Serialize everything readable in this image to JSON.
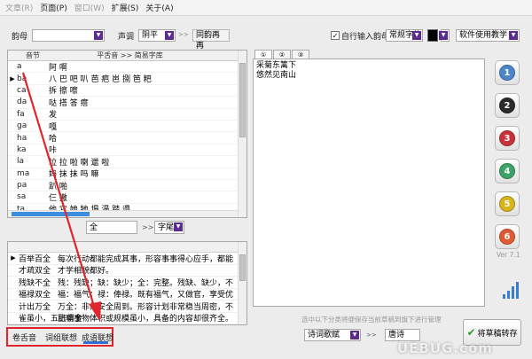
{
  "menu": [
    "文章(R)",
    "页面(P)",
    "窗口(W)",
    "扩展(S)",
    "关于(A)"
  ],
  "toolbar": {
    "rhyme_label": "韵母",
    "rhyme_value": "",
    "tone_label": "声调",
    "tone_value": "阴平",
    "arrows": ">>",
    "same_rhyme_btn": "同韵再再",
    "auto_input_label": "自行输入韵母",
    "font_value": "常规字体",
    "usage_value": "软件使用教学"
  },
  "syllable_grid": {
    "headers": [
      "音节",
      "平舌音 >> 简易字库"
    ],
    "rows": [
      {
        "syl": "a",
        "chars": "阿 啊"
      },
      {
        "syl": "ba",
        "chars": "八 巴 吧 叭 芭 疤 岜 捌 笆 粑"
      },
      {
        "syl": "ca",
        "chars": "拆 擦 嚓"
      },
      {
        "syl": "da",
        "chars": "哒 搭 答 瘩"
      },
      {
        "syl": "fa",
        "chars": "发"
      },
      {
        "syl": "ga",
        "chars": "嘎"
      },
      {
        "syl": "ha",
        "chars": "哈"
      },
      {
        "syl": "ka",
        "chars": "咔"
      },
      {
        "syl": "la",
        "chars": "垃 拉 啦 喇 邋 啦"
      },
      {
        "syl": "ma",
        "chars": "妈 抹 抹 吗 嘛"
      },
      {
        "syl": "pa",
        "chars": "趴 啪"
      },
      {
        "syl": "sa",
        "chars": "仨 撒"
      },
      {
        "syl": "ta",
        "chars": "他 它 她 牠 塌 溻 踏 遢"
      }
    ]
  },
  "search": {
    "value": "全",
    "arrows": ">>",
    "position_value": "字尾"
  },
  "phrases": [
    {
      "word": "百举百全",
      "desc": "每次行动都能完成其事，形容事事得心应手，都能"
    },
    {
      "word": "才疏双全",
      "desc": "才学相貌都好。"
    },
    {
      "word": "残缺不全",
      "desc": "残：残缺；缺：缺少；全：完整。残缺、缺少，不"
    },
    {
      "word": "福禄双全",
      "desc": "福：福气；禄：俸禄。既有福气，又做官，享受优"
    },
    {
      "word": "计出万全",
      "desc": "万全：非常安全周到。形容计划非常稳当周密，不"
    },
    {
      "word": "雀虽小，五脏俱全",
      "desc": "比喻事物体积或规模虽小，具备的内容却很齐全。"
    }
  ],
  "bottom_tabs": [
    "卷舌音",
    "词组联想",
    "成语联想"
  ],
  "editor": {
    "tabs": [
      "①",
      "②",
      "③"
    ],
    "lines": [
      "采菊东篱下",
      "悠然见南山"
    ]
  },
  "right_footer": {
    "hint": "选中以下分类将便保存当前草稿到旗下进行管理",
    "category_value": "诗词歌赋",
    "arrows": ">>",
    "dynasty_value": "唐诗",
    "save_label": "将草稿转存"
  },
  "version": "Ver 7.1",
  "side_buttons": [
    {
      "num": "1",
      "color": "#4a86c8"
    },
    {
      "num": "2",
      "color": "#2b2b2b"
    },
    {
      "num": "3",
      "color": "#c8323c"
    },
    {
      "num": "4",
      "color": "#3ca468"
    },
    {
      "num": "5",
      "color": "#d9b51c"
    },
    {
      "num": "6",
      "color": "#e05a34"
    }
  ],
  "watermark": "UEBUG.com",
  "colors": {
    "accent": "#5b2c8f",
    "highlight": "#e0262c",
    "tab_underline": "#2f6fd1"
  }
}
